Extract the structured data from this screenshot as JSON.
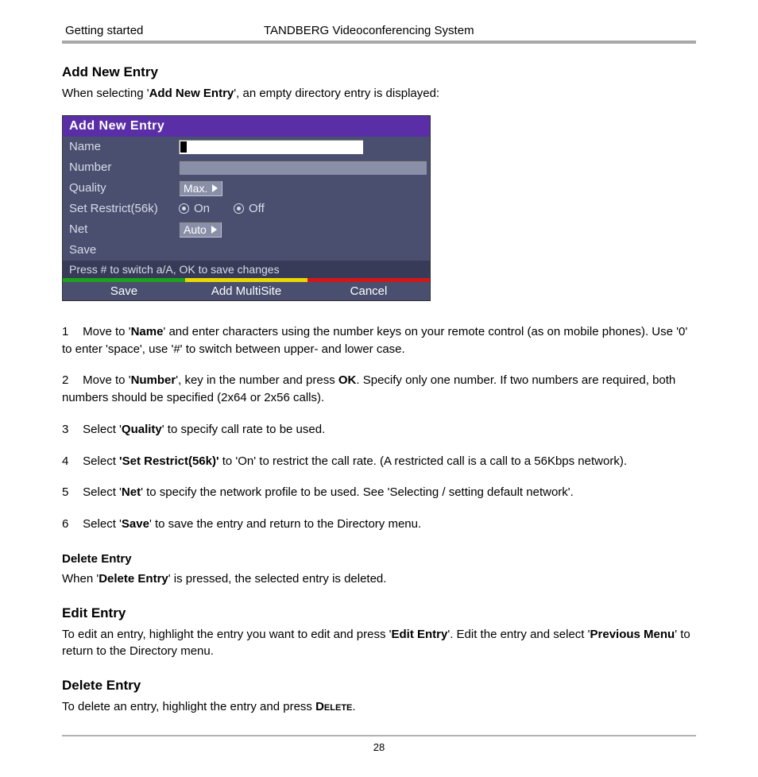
{
  "header": {
    "left": "Getting started",
    "center": "TANDBERG Videoconferencing System"
  },
  "section_add": {
    "heading": "Add New Entry",
    "intro_pre": "When selecting '",
    "intro_bold": "Add New Entry",
    "intro_post": "', an empty directory entry is displayed:"
  },
  "ui": {
    "title": "Add New Entry",
    "rows": {
      "name": "Name",
      "number": "Number",
      "quality": "Quality",
      "restrict": "Set Restrict(56k)",
      "net": "Net",
      "save": "Save"
    },
    "quality_value": "Max.",
    "restrict_on": "On",
    "restrict_off": "Off",
    "net_value": "Auto",
    "hint": "Press # to switch a/A, OK to save changes",
    "buttons": {
      "save": "Save",
      "multisite": "Add MultiSite",
      "cancel": "Cancel"
    }
  },
  "steps": {
    "s1": {
      "num": "1",
      "pre": "Move to '",
      "b1": "Name",
      "post": "' and enter characters using the number keys on your remote control (as on mobile phones). Use '0' to enter 'space', use '#' to switch between upper- and lower case."
    },
    "s2": {
      "num": "2",
      "pre": "Move to '",
      "b1": "Number",
      "mid": "', key in the number and press ",
      "b2": "OK",
      "post": ". Specify only one number. If two numbers are required, both numbers should be specified (2x64 or 2x56 calls)."
    },
    "s3": {
      "num": "3",
      "pre": "Select '",
      "b1": "Quality",
      "post": "' to specify call rate to be used."
    },
    "s4": {
      "num": "4",
      "pre": " Select ",
      "b1": "'Set Restrict(56k)'",
      "post": " to 'On' to restrict the call rate. (A restricted call is a call to a 56Kbps network)."
    },
    "s5": {
      "num": "5",
      "pre": "Select '",
      "b1": "Net",
      "post": "' to specify the network profile to be used. See 'Selecting / setting default network'."
    },
    "s6": {
      "num": "6",
      "pre": "Select '",
      "b1": "Save",
      "post": "' to save the entry and return to the Directory menu."
    }
  },
  "delete_small": {
    "heading": "Delete Entry",
    "pre": "When '",
    "b1": "Delete Entry",
    "post": "' is pressed, the selected entry is deleted."
  },
  "edit": {
    "heading": "Edit Entry",
    "pre": "To edit an entry, highlight the entry you want to edit and press '",
    "b1": "Edit Entry",
    "mid": "'. Edit the entry and select '",
    "b2": "Previous Menu",
    "post": "' to return to the Directory menu."
  },
  "delete_big": {
    "heading": "Delete Entry",
    "pre": "To delete an entry, highlight the entry and press ",
    "b1": "Delete",
    "post": "."
  },
  "page_number": "28"
}
